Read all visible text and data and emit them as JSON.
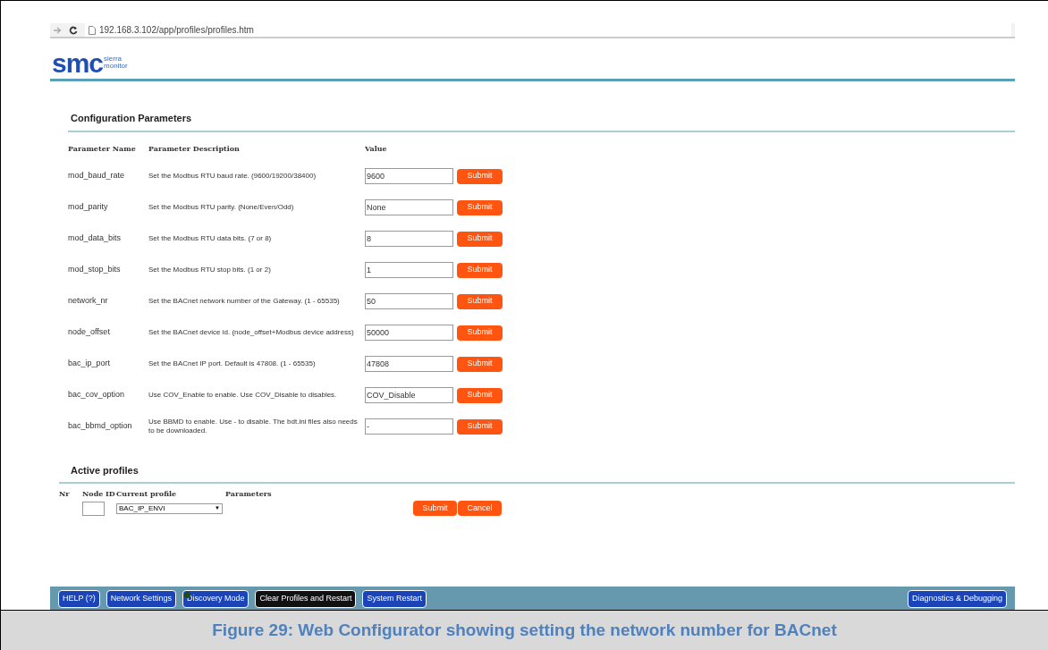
{
  "browser": {
    "url": "192.168.3.102/app/profiles/profiles.htm"
  },
  "logo": {
    "text": "smc",
    "subtitle_1": "sierra",
    "subtitle_2": "monitor"
  },
  "config": {
    "title": "Configuration Parameters",
    "columns": [
      "Parameter Name",
      "Parameter Description",
      "Value"
    ],
    "rows": [
      {
        "name": "mod_baud_rate",
        "description": "Set the Modbus RTU baud rate. (9600/19200/38400)",
        "value": "9600",
        "button": "Submit"
      },
      {
        "name": "mod_parity",
        "description": "Set the Modbus RTU parity. (None/Even/Odd)",
        "value": "None",
        "button": "Submit"
      },
      {
        "name": "mod_data_bits",
        "description": "Set the Modbus RTU data bits. (7 or 8)",
        "value": "8",
        "button": "Submit"
      },
      {
        "name": "mod_stop_bits",
        "description": "Set the Modbus RTU stop bits. (1 or 2)",
        "value": "1",
        "button": "Submit"
      },
      {
        "name": "network_nr",
        "description": "Set the BACnet network number of the Gateway. (1 - 65535)",
        "value": "50",
        "button": "Submit"
      },
      {
        "name": "node_offset",
        "description": "Set the BACnet device id. (node_offset+Modbus device address)",
        "value": "50000",
        "button": "Submit"
      },
      {
        "name": "bac_ip_port",
        "description": "Set the BACnet IP port. Default is 47808. (1 - 65535)",
        "value": "47808",
        "button": "Submit"
      },
      {
        "name": "bac_cov_option",
        "description": "Use COV_Enable to enable. Use COV_Disable to disables.",
        "value": "COV_Disable",
        "button": "Submit"
      },
      {
        "name": "bac_bbmd_option",
        "description": "Use BBMD to enable. Use - to disable. The bdt.ini files also needs to be downloaded.",
        "value": "-",
        "button": "Submit"
      }
    ]
  },
  "profiles": {
    "title": "Active profiles",
    "columns": [
      "Nr",
      "Node ID",
      "Current profile",
      "Parameters"
    ],
    "profile": "BAC_IP_ENVI",
    "select_arrow": "▼",
    "buttons": [
      "Submit",
      "Cancel"
    ]
  },
  "toolbar": {
    "left": [
      {
        "label": "HELP (?)",
        "selected": false,
        "indicator": false
      },
      {
        "label": "Network Settings",
        "selected": false,
        "indicator": false
      },
      {
        "label": "Discovery Mode",
        "selected": false,
        "indicator": true
      },
      {
        "label": "Clear Profiles and Restart",
        "selected": true,
        "indicator": false
      },
      {
        "label": "System Restart",
        "selected": false,
        "indicator": false
      }
    ],
    "right": [
      {
        "label": "Diagnostics & Debugging",
        "selected": false,
        "indicator": false
      }
    ]
  },
  "caption": "Figure 29: Web Configurator showing setting the network number for BACnet"
}
